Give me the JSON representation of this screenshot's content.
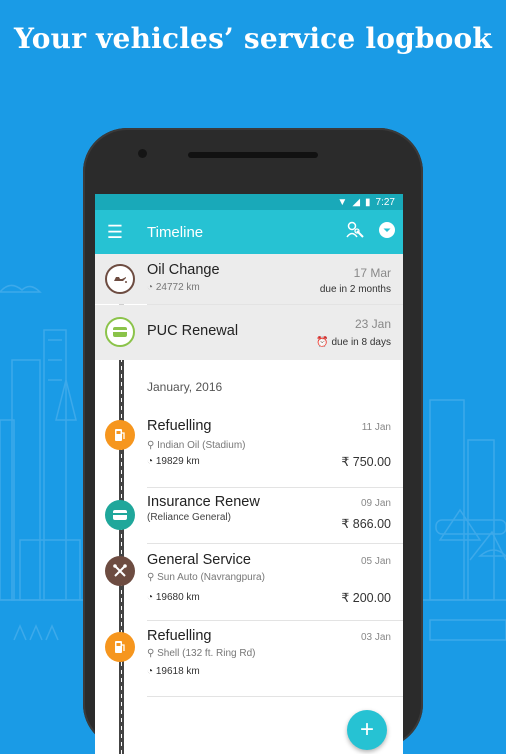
{
  "headline": "Your vehicles’ service logbook",
  "colors": {
    "background": "#1a9be6",
    "appbar": "#26c2d3",
    "orange": "#f6961e",
    "teal": "#1fa79b",
    "brown": "#6d4c41",
    "green": "#8bc34a",
    "rail": "#444444"
  },
  "statusbar": {
    "time": "7:27"
  },
  "appbar": {
    "title": "Timeline",
    "menu_icon": "hamburger-icon",
    "action_icon": "mechanic-icon",
    "dropdown_icon": "chevron-down-icon"
  },
  "reminders": [
    {
      "title": "Oil Change",
      "date": "17 Mar",
      "odometer": "24772 km",
      "due": "due in 2 months",
      "icon": "oil-can-icon",
      "color": "brown"
    },
    {
      "title": "PUC Renewal",
      "date": "23 Jan",
      "due": "due in 8 days",
      "icon": "card-icon",
      "color": "green"
    }
  ],
  "month_header": "January, 2016",
  "entries": [
    {
      "title": "Refuelling",
      "date": "11 Jan",
      "location": "Indian Oil (Stadium)",
      "odometer": "19829 km",
      "amount": "₹ 750.00",
      "icon": "fuel-icon",
      "color": "orange"
    },
    {
      "title": "Insurance Renew",
      "date": "09 Jan",
      "location": "(Reliance General)",
      "amount": "₹ 866.00",
      "icon": "card-icon",
      "color": "teal"
    },
    {
      "title": "General Service",
      "date": "05 Jan",
      "location": "Sun Auto (Navrangpura)",
      "odometer": "19680 km",
      "amount": "₹ 200.00",
      "icon": "wrench-icon",
      "color": "brown"
    },
    {
      "title": "Refuelling",
      "date": "03 Jan",
      "location": "Shell (132 ft. Ring Rd)",
      "odometer": "19618 km",
      "icon": "fuel-icon",
      "color": "orange"
    }
  ],
  "fab": {
    "label": "+"
  }
}
